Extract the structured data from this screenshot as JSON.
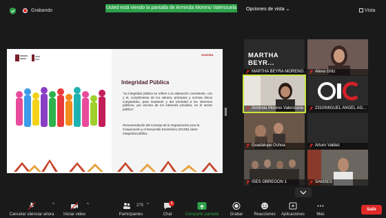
{
  "topbar": {
    "recording_label": "Grabando",
    "banner_text": "Usted está viendo la pantalla de Arminda Moreno Valenzuela",
    "view_options": "Opciones de vista ⌄",
    "view_label": "Vista"
  },
  "slide": {
    "sonora_logo": "SONORA",
    "title": "Integridad Pública",
    "body": "\"La integridad pública se refiere a la alineación consistente, con y el, cumplimiento de los valores, principios y normas éticos compartidos, para mantener y dar prioridad a los intereses públicos, por encima de los intereses privados, en el sector público\".",
    "reference": "Recomendación del Consejo de la Organización para la Cooperación y el Desarrollo Económico (OCDE) sobre Integridad pública"
  },
  "participants": [
    {
      "name": "MARTHA BEYRA MORENO...",
      "big_label": "MARTHA BEYR...",
      "bg": "#1f1f1f"
    },
    {
      "name": "Alexa Ortiz",
      "bg": "#5a4a46"
    },
    {
      "name": "Arminda Moreno Valenzuela",
      "bg": "#c9c3bd"
    },
    {
      "name": "2310/MIGUEL ANGEL AG...",
      "bg": "#2b2b2b"
    },
    {
      "name": "Guadalupe Ochoa",
      "bg": "#6a5648"
    },
    {
      "name": "Arturo Valdez",
      "bg": "#343434"
    },
    {
      "name": "ISES OBREGON 1",
      "bg": "#55504a"
    },
    {
      "name": "SAMSES",
      "bg": "#6b6660"
    }
  ],
  "toolbar": {
    "mute": "Cancelar silenciar ahora",
    "video": "Iniciar video",
    "participants": "Participantes",
    "participants_count": "275",
    "chat": "Chat",
    "chat_badge": "4",
    "share": "Compartir pantalla",
    "record": "Grabar",
    "reactions": "Reacciones",
    "apps": "Aplicaciones",
    "more": "Más",
    "leave": "Salir"
  },
  "colors": {
    "accent_green": "#2ea04a",
    "leave_red": "#e02828",
    "active_speaker": "#c8e63c"
  }
}
